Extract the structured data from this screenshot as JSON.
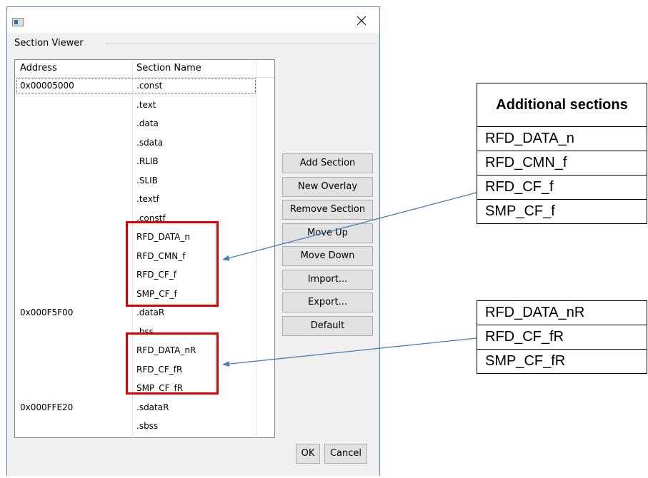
{
  "dialog": {
    "group_title": "Section Viewer",
    "columns": [
      "Address",
      "Section Name"
    ],
    "rows": [
      {
        "address": "0x00005000",
        "name": ".const"
      },
      {
        "address": "",
        "name": ".text"
      },
      {
        "address": "",
        "name": ".data"
      },
      {
        "address": "",
        "name": ".sdata"
      },
      {
        "address": "",
        "name": ".RLIB"
      },
      {
        "address": "",
        "name": ".SLIB"
      },
      {
        "address": "",
        "name": ".textf"
      },
      {
        "address": "",
        "name": ".constf"
      },
      {
        "address": "",
        "name": "RFD_DATA_n"
      },
      {
        "address": "",
        "name": "RFD_CMN_f"
      },
      {
        "address": "",
        "name": "RFD_CF_f"
      },
      {
        "address": "",
        "name": "SMP_CF_f"
      },
      {
        "address": "0x000F5F00",
        "name": ".dataR"
      },
      {
        "address": "",
        "name": ".bss"
      },
      {
        "address": "",
        "name": "RFD_DATA_nR"
      },
      {
        "address": "",
        "name": "RFD_CF_fR"
      },
      {
        "address": "",
        "name": "SMP_CF_fR"
      },
      {
        "address": "0x000FFE20",
        "name": ".sdataR"
      },
      {
        "address": "",
        "name": ".sbss"
      }
    ],
    "buttons": {
      "add_section": "Add Section",
      "new_overlay": "New Overlay",
      "remove_section": "Remove Section",
      "move_up": "Move Up",
      "move_down": "Move Down",
      "import": "Import...",
      "export": "Export...",
      "default": "Default",
      "ok": "OK",
      "cancel": "Cancel"
    }
  },
  "annotation": {
    "table1_header": "Additional sections",
    "table1_rows": [
      "RFD_DATA_n",
      "RFD_CMN_f",
      "RFD_CF_f",
      "SMP_CF_f"
    ],
    "table2_rows": [
      "RFD_DATA_nR",
      "RFD_CF_fR",
      "SMP_CF_fR"
    ],
    "highlight_color": "#e00000",
    "arrow_color": "#4a7ebb"
  }
}
